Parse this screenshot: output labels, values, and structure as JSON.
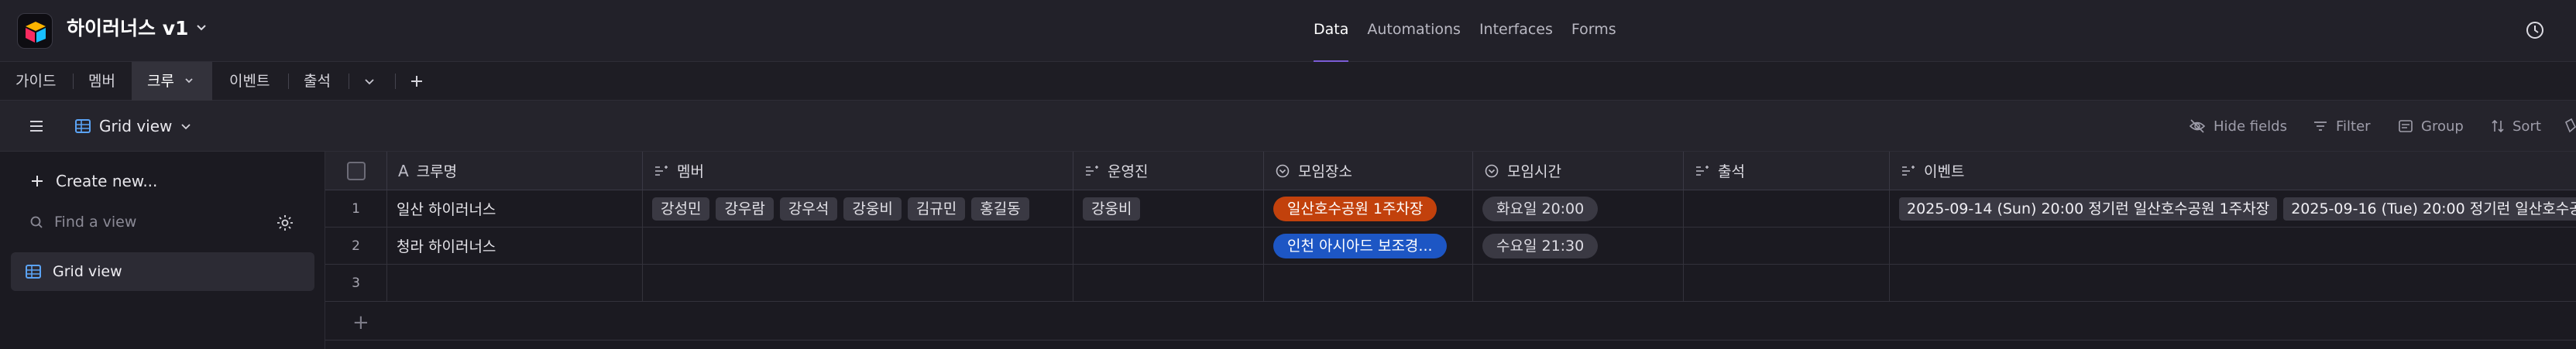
{
  "app": {
    "title": "하이러너스 v1"
  },
  "nav": {
    "data": "Data",
    "automations": "Automations",
    "interfaces": "Interfaces",
    "forms": "Forms"
  },
  "tabs": [
    "가이드",
    "멤버",
    "크루",
    "이벤트",
    "출석"
  ],
  "toolbar": {
    "view_name": "Grid view",
    "hide_fields": "Hide fields",
    "filter": "Filter",
    "group": "Group",
    "sort": "Sort"
  },
  "sidebar": {
    "create": "Create new...",
    "find_placeholder": "Find a view",
    "views": [
      "Grid view"
    ]
  },
  "columns": [
    "크루명",
    "멤버",
    "운영진",
    "모임장소",
    "모임시간",
    "출석",
    "이벤트"
  ],
  "rows": [
    {
      "num": "1",
      "name": "일산 하이러너스",
      "members": [
        "강성민",
        "강우람",
        "강우석",
        "강웅비",
        "김규민",
        "홍길동"
      ],
      "staff": [
        "강웅비"
      ],
      "place": "일산호수공원 1주차장",
      "time": "화요일 20:00",
      "events": [
        "2025-09-14 (Sun) 20:00 정기런 일산호수공원 1주차장",
        "2025-09-16 (Tue) 20:00 정기런 일산호수공"
      ]
    },
    {
      "num": "2",
      "name": "청라 하이러너스",
      "members": [],
      "staff": [],
      "place": "인천 아시아드 보조경...",
      "time": "수요일 21:30",
      "events": []
    },
    {
      "num": "3",
      "name": "",
      "members": [],
      "staff": [],
      "place": "",
      "time": "",
      "events": []
    }
  ],
  "colors": {
    "accent": "#7b5cd6",
    "orange": "#c2410c",
    "blue": "#1d56c4"
  }
}
